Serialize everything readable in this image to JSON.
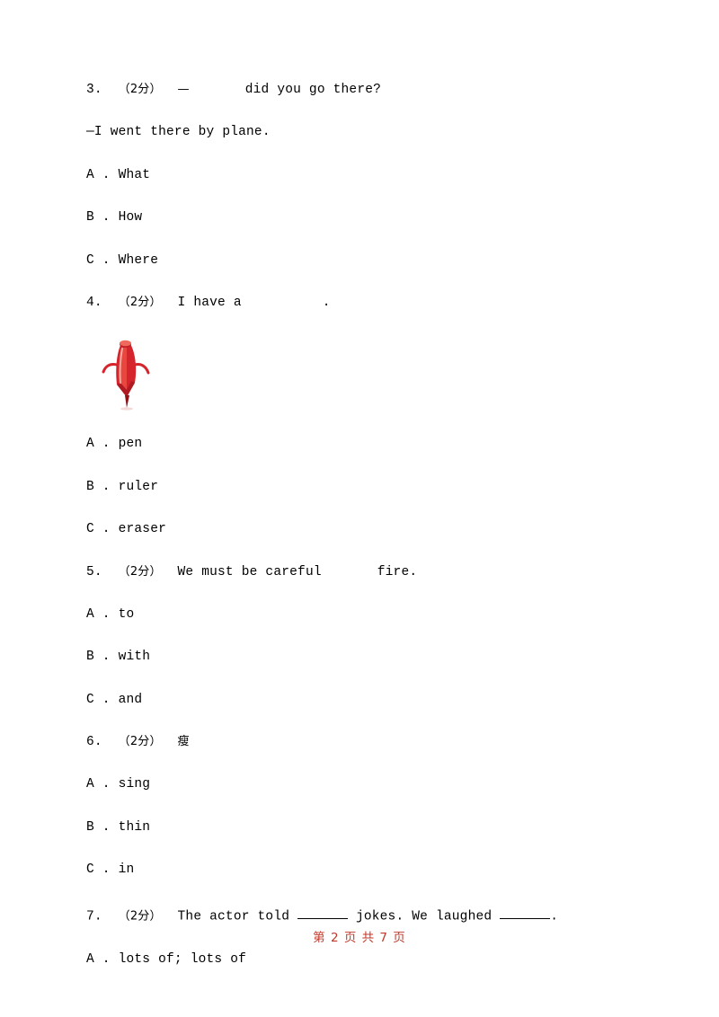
{
  "page": {
    "footer": "第 2 页 共 7 页",
    "footer_color": "#c0392b"
  },
  "questions": [
    {
      "num": "3.",
      "marks": "（2分）",
      "stem": "—",
      "stem_after": "did you go there?",
      "continuation": "—I went there by plane.",
      "options": [
        "A . What",
        "B . How",
        "C . Where"
      ]
    },
    {
      "num": "4.",
      "marks": "（2分）",
      "stem": "I have a",
      "stem_after": ".",
      "image": "red-pen-illustration",
      "options": [
        "A . pen",
        "B . ruler",
        "C . eraser"
      ]
    },
    {
      "num": "5.",
      "marks": "（2分）",
      "stem": "We must be careful",
      "stem_after": "fire.",
      "options": [
        "A . to",
        "B . with",
        "C . and"
      ]
    },
    {
      "num": "6.",
      "marks": "（2分）",
      "stem": "瘦",
      "stem_after": "",
      "options": [
        "A . sing",
        "B . thin",
        "C . in"
      ]
    },
    {
      "num": "7.",
      "marks": "（2分）",
      "stem": "The actor told",
      "stem_mid": "jokes. We laughed",
      "stem_after": ".",
      "options": [
        "A . lots of; lots of"
      ]
    }
  ]
}
